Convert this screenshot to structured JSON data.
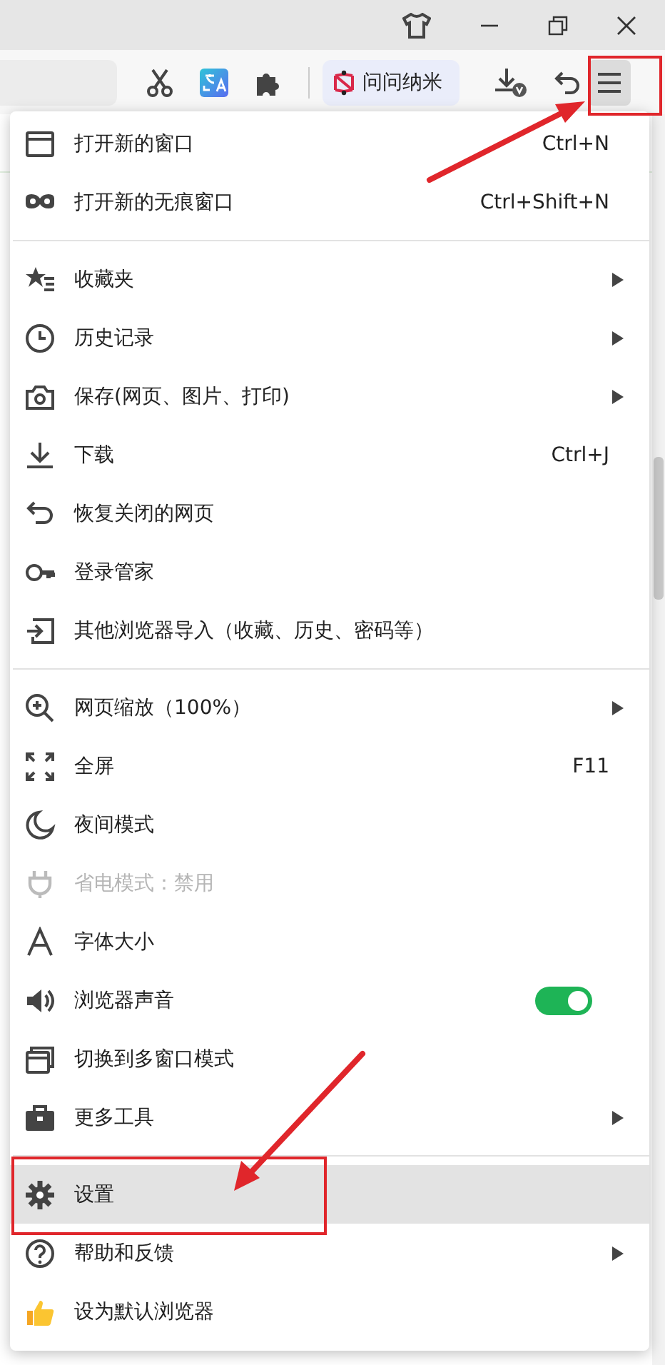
{
  "toolbar": {
    "assistant_label": "问问纳米",
    "menu_button": {
      "pressed": true
    }
  },
  "menu": {
    "sections": [
      {
        "items": [
          {
            "kind": "shortcut",
            "label": "打开新的窗口",
            "shortcut": "Ctrl+N",
            "disabled": false,
            "selected": false
          },
          {
            "kind": "shortcut",
            "label": "打开新的无痕窗口",
            "shortcut": "Ctrl+Shift+N",
            "disabled": false,
            "selected": false
          }
        ]
      },
      {
        "items": [
          {
            "kind": "submenu",
            "label": "收藏夹",
            "disabled": false,
            "selected": false
          },
          {
            "kind": "submenu",
            "label": "历史记录",
            "disabled": false,
            "selected": false
          },
          {
            "kind": "submenu",
            "label": "保存(网页、图片、打印)",
            "disabled": false,
            "selected": false
          },
          {
            "kind": "shortcut",
            "label": "下载",
            "shortcut": "Ctrl+J",
            "disabled": false,
            "selected": false
          },
          {
            "kind": "action",
            "label": "恢复关闭的网页",
            "disabled": false,
            "selected": false
          },
          {
            "kind": "action",
            "label": "登录管家",
            "disabled": false,
            "selected": false
          },
          {
            "kind": "action",
            "label": "其他浏览器导入（收藏、历史、密码等）",
            "disabled": false,
            "selected": false
          }
        ]
      },
      {
        "items": [
          {
            "kind": "submenu",
            "label": "网页缩放（100%）",
            "disabled": false,
            "selected": false
          },
          {
            "kind": "shortcut",
            "label": "全屏",
            "shortcut": "F11",
            "disabled": false,
            "selected": false
          },
          {
            "kind": "action",
            "label": "夜间模式",
            "disabled": false,
            "selected": false
          },
          {
            "kind": "action",
            "label": "省电模式：禁用",
            "disabled": true,
            "selected": false
          },
          {
            "kind": "action",
            "label": "字体大小",
            "disabled": false,
            "selected": false
          },
          {
            "kind": "toggle",
            "label": "浏览器声音",
            "on": true,
            "disabled": false,
            "selected": false
          },
          {
            "kind": "action",
            "label": "切换到多窗口模式",
            "disabled": false,
            "selected": false
          },
          {
            "kind": "submenu",
            "label": "更多工具",
            "disabled": false,
            "selected": false
          }
        ]
      },
      {
        "items": [
          {
            "kind": "action",
            "label": "设置",
            "disabled": false,
            "selected": true
          },
          {
            "kind": "submenu",
            "label": "帮助和反馈",
            "disabled": false,
            "selected": false
          },
          {
            "kind": "action",
            "label": "设为默认浏览器",
            "disabled": false,
            "selected": false
          }
        ]
      }
    ]
  }
}
